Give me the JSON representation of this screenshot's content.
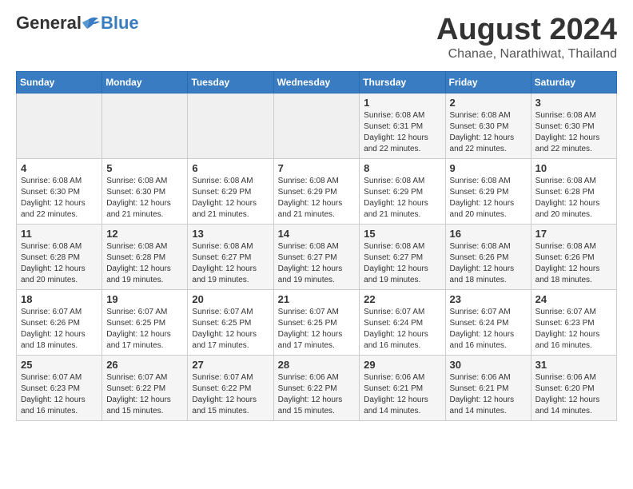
{
  "header": {
    "logo_general": "General",
    "logo_blue": "Blue",
    "main_title": "August 2024",
    "subtitle": "Chanae, Narathiwat, Thailand"
  },
  "calendar": {
    "days_of_week": [
      "Sunday",
      "Monday",
      "Tuesday",
      "Wednesday",
      "Thursday",
      "Friday",
      "Saturday"
    ],
    "weeks": [
      [
        {
          "day": "",
          "info": ""
        },
        {
          "day": "",
          "info": ""
        },
        {
          "day": "",
          "info": ""
        },
        {
          "day": "",
          "info": ""
        },
        {
          "day": "1",
          "info": "Sunrise: 6:08 AM\nSunset: 6:31 PM\nDaylight: 12 hours and 22 minutes."
        },
        {
          "day": "2",
          "info": "Sunrise: 6:08 AM\nSunset: 6:30 PM\nDaylight: 12 hours and 22 minutes."
        },
        {
          "day": "3",
          "info": "Sunrise: 6:08 AM\nSunset: 6:30 PM\nDaylight: 12 hours and 22 minutes."
        }
      ],
      [
        {
          "day": "4",
          "info": "Sunrise: 6:08 AM\nSunset: 6:30 PM\nDaylight: 12 hours and 22 minutes."
        },
        {
          "day": "5",
          "info": "Sunrise: 6:08 AM\nSunset: 6:30 PM\nDaylight: 12 hours and 21 minutes."
        },
        {
          "day": "6",
          "info": "Sunrise: 6:08 AM\nSunset: 6:29 PM\nDaylight: 12 hours and 21 minutes."
        },
        {
          "day": "7",
          "info": "Sunrise: 6:08 AM\nSunset: 6:29 PM\nDaylight: 12 hours and 21 minutes."
        },
        {
          "day": "8",
          "info": "Sunrise: 6:08 AM\nSunset: 6:29 PM\nDaylight: 12 hours and 21 minutes."
        },
        {
          "day": "9",
          "info": "Sunrise: 6:08 AM\nSunset: 6:29 PM\nDaylight: 12 hours and 20 minutes."
        },
        {
          "day": "10",
          "info": "Sunrise: 6:08 AM\nSunset: 6:28 PM\nDaylight: 12 hours and 20 minutes."
        }
      ],
      [
        {
          "day": "11",
          "info": "Sunrise: 6:08 AM\nSunset: 6:28 PM\nDaylight: 12 hours and 20 minutes."
        },
        {
          "day": "12",
          "info": "Sunrise: 6:08 AM\nSunset: 6:28 PM\nDaylight: 12 hours and 19 minutes."
        },
        {
          "day": "13",
          "info": "Sunrise: 6:08 AM\nSunset: 6:27 PM\nDaylight: 12 hours and 19 minutes."
        },
        {
          "day": "14",
          "info": "Sunrise: 6:08 AM\nSunset: 6:27 PM\nDaylight: 12 hours and 19 minutes."
        },
        {
          "day": "15",
          "info": "Sunrise: 6:08 AM\nSunset: 6:27 PM\nDaylight: 12 hours and 19 minutes."
        },
        {
          "day": "16",
          "info": "Sunrise: 6:08 AM\nSunset: 6:26 PM\nDaylight: 12 hours and 18 minutes."
        },
        {
          "day": "17",
          "info": "Sunrise: 6:08 AM\nSunset: 6:26 PM\nDaylight: 12 hours and 18 minutes."
        }
      ],
      [
        {
          "day": "18",
          "info": "Sunrise: 6:07 AM\nSunset: 6:26 PM\nDaylight: 12 hours and 18 minutes."
        },
        {
          "day": "19",
          "info": "Sunrise: 6:07 AM\nSunset: 6:25 PM\nDaylight: 12 hours and 17 minutes."
        },
        {
          "day": "20",
          "info": "Sunrise: 6:07 AM\nSunset: 6:25 PM\nDaylight: 12 hours and 17 minutes."
        },
        {
          "day": "21",
          "info": "Sunrise: 6:07 AM\nSunset: 6:25 PM\nDaylight: 12 hours and 17 minutes."
        },
        {
          "day": "22",
          "info": "Sunrise: 6:07 AM\nSunset: 6:24 PM\nDaylight: 12 hours and 16 minutes."
        },
        {
          "day": "23",
          "info": "Sunrise: 6:07 AM\nSunset: 6:24 PM\nDaylight: 12 hours and 16 minutes."
        },
        {
          "day": "24",
          "info": "Sunrise: 6:07 AM\nSunset: 6:23 PM\nDaylight: 12 hours and 16 minutes."
        }
      ],
      [
        {
          "day": "25",
          "info": "Sunrise: 6:07 AM\nSunset: 6:23 PM\nDaylight: 12 hours and 16 minutes."
        },
        {
          "day": "26",
          "info": "Sunrise: 6:07 AM\nSunset: 6:22 PM\nDaylight: 12 hours and 15 minutes."
        },
        {
          "day": "27",
          "info": "Sunrise: 6:07 AM\nSunset: 6:22 PM\nDaylight: 12 hours and 15 minutes."
        },
        {
          "day": "28",
          "info": "Sunrise: 6:06 AM\nSunset: 6:22 PM\nDaylight: 12 hours and 15 minutes."
        },
        {
          "day": "29",
          "info": "Sunrise: 6:06 AM\nSunset: 6:21 PM\nDaylight: 12 hours and 14 minutes."
        },
        {
          "day": "30",
          "info": "Sunrise: 6:06 AM\nSunset: 6:21 PM\nDaylight: 12 hours and 14 minutes."
        },
        {
          "day": "31",
          "info": "Sunrise: 6:06 AM\nSunset: 6:20 PM\nDaylight: 12 hours and 14 minutes."
        }
      ]
    ]
  }
}
